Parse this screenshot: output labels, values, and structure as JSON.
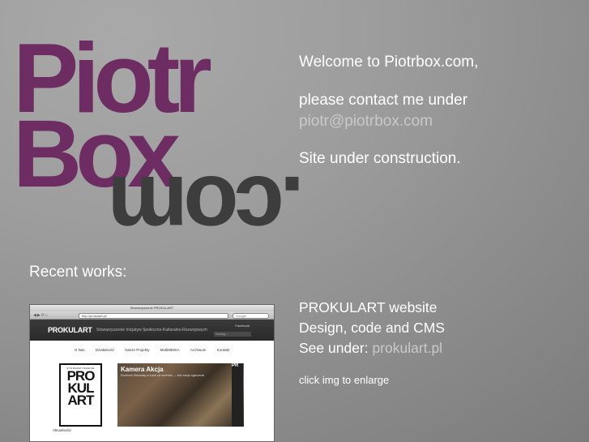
{
  "logo": {
    "line1": "Piotr",
    "line2": "Box",
    "line3": ".com",
    "colors": {
      "primary": "#6e2d62",
      "secondary": "#3d3d3d"
    }
  },
  "intro": {
    "welcome": "Welcome to Piotrbox.com,",
    "contact_prefix": "please contact me under",
    "email": "piotr@piotrbox.com",
    "status": "Site under construction."
  },
  "recent": {
    "heading": "Recent works:"
  },
  "work": {
    "title": "PROKULART website",
    "subtitle": "Design, code and CMS",
    "see_prefix": "See under:",
    "link": "prokulart.pl",
    "enlarge_hint": "click img to enlarge"
  },
  "thumbnail": {
    "window_title": "Stowarzyszenie PROKULART",
    "url": "http://prokulart.pl/",
    "search_placeholder": "Google",
    "brand": "PROKULART",
    "tagline": "Stowarzyszenie Inicjatyw Społeczno-Kulturalno-Rozwojowych",
    "facebook": "Facebook",
    "find_label": "Szukaj...",
    "nav": [
      "O Nas",
      "Działalność",
      "Nasze Projekty",
      "MultiMEDIA",
      "Archiwum",
      "Kontakt"
    ],
    "poster_top": "STOWARZYSZENIE",
    "poster_l1": "PRO",
    "poster_l2": "KUL",
    "poster_l3": "ART",
    "photo_title": "Kamera Akcja",
    "photo_caption": "Rodzinne Warsztaty w Łodzi we wrześniu — złóż swoje zgłoszenie",
    "side_text": "PR",
    "footer_text": "Aktualności"
  }
}
